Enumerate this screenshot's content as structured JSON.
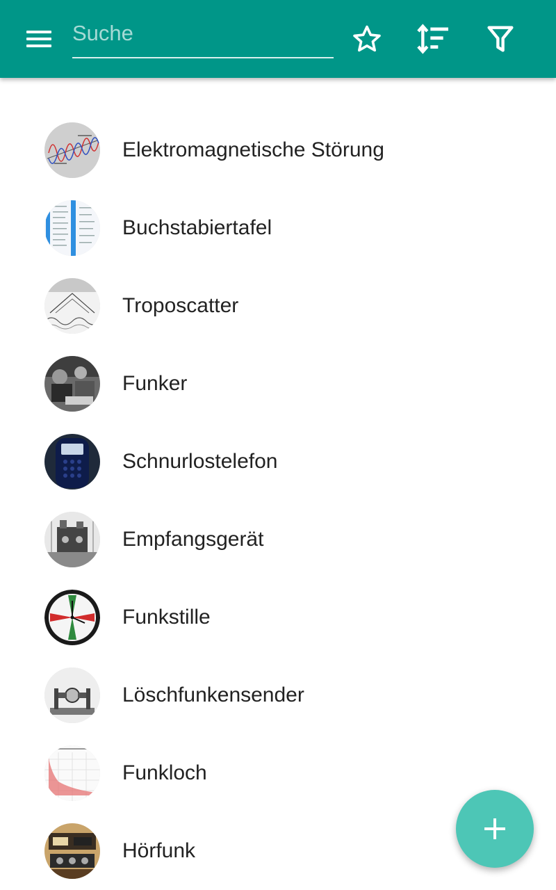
{
  "app_bar": {
    "search": {
      "placeholder": "Suche",
      "value": ""
    },
    "icons": {
      "menu": "menu-icon",
      "favorite": "star-outline-icon",
      "sort": "sort-icon",
      "filter": "filter-icon"
    },
    "background": "#009688"
  },
  "list": {
    "items": [
      {
        "label": "Elektromagnetische Störung",
        "thumbnail": "wave-diagram"
      },
      {
        "label": "Buchstabiertafel",
        "thumbnail": "table-sheet"
      },
      {
        "label": "Troposcatter",
        "thumbnail": "scatter-diagram"
      },
      {
        "label": "Funker",
        "thumbnail": "photo-operator"
      },
      {
        "label": "Schnurlostelefon",
        "thumbnail": "cordless-phone"
      },
      {
        "label": "Empfangsgerät",
        "thumbnail": "receiver-device"
      },
      {
        "label": "Funkstille",
        "thumbnail": "clock-dial"
      },
      {
        "label": "Löschfunkensender",
        "thumbnail": "spark-transmitter"
      },
      {
        "label": "Funkloch",
        "thumbnail": "red-chart"
      },
      {
        "label": "Hörfunk",
        "thumbnail": "radio-studio"
      }
    ]
  },
  "fab": {
    "icon": "plus-icon",
    "color": "#4dc6b6"
  }
}
